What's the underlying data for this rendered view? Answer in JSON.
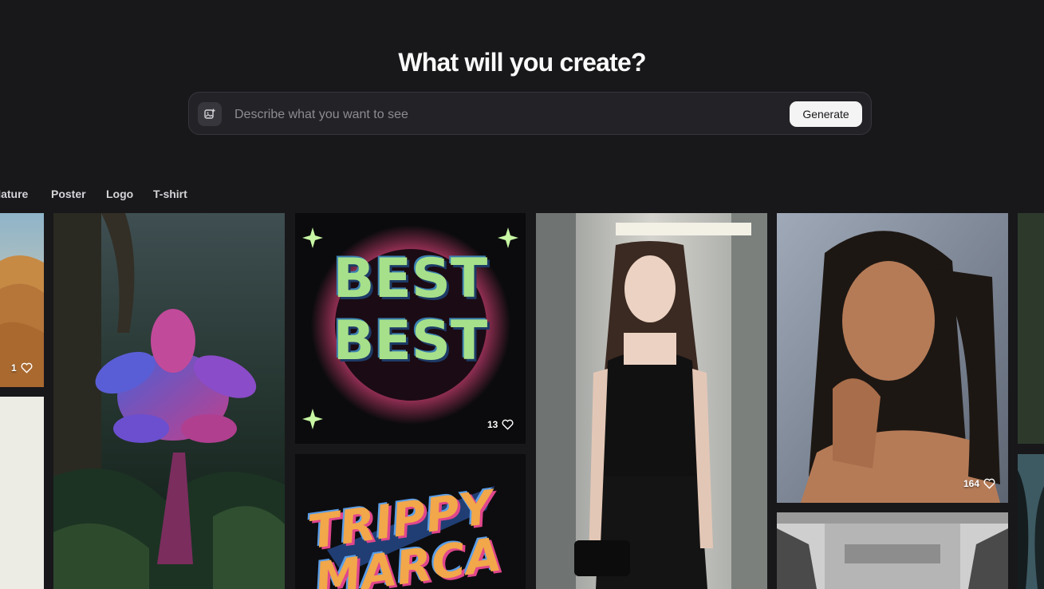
{
  "hero": {
    "title": "What will you create?",
    "prompt_placeholder": "Describe what you want to see",
    "generate_label": "Generate",
    "image_upload_icon": "image-plus-icon"
  },
  "categories": [
    "Nature",
    "Poster",
    "Logo",
    "T-shirt"
  ],
  "gallery": {
    "desert": {
      "likes": "1"
    },
    "best_poster": {
      "likes": "13",
      "text_line1": "BEST",
      "text_line2": "BEST"
    },
    "portrait": {
      "likes": "164"
    },
    "trippy": {
      "text_line1": "TRIPPY",
      "text_line2": "MARCA"
    }
  },
  "colors": {
    "background": "#18181b",
    "prompt_bar": "#232327",
    "button": "#f4f4f5"
  }
}
